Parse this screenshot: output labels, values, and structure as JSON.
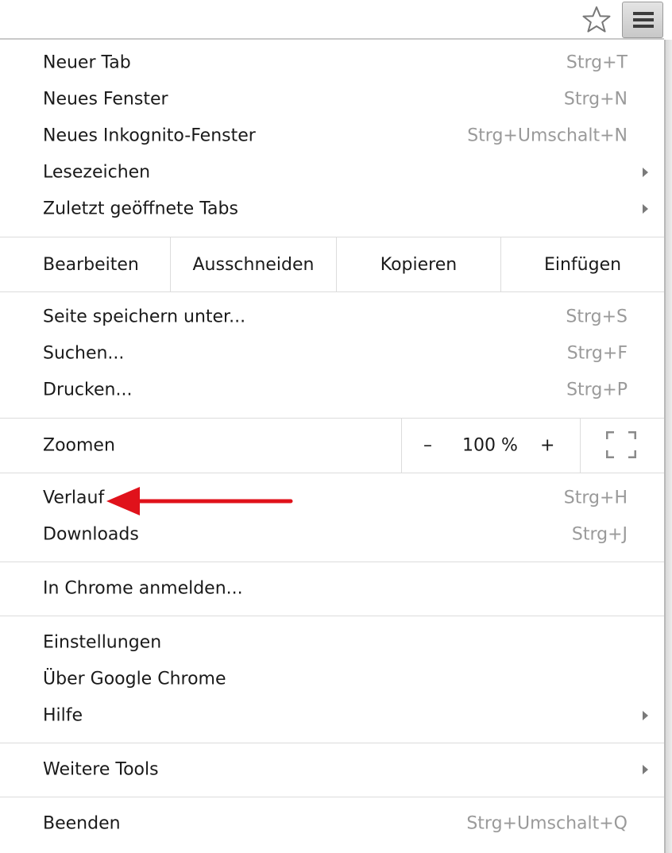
{
  "toolbar": {
    "bookmark_icon": "star-icon",
    "menu_icon": "hamburger-menu-icon"
  },
  "menu": {
    "group1": [
      {
        "label": "Neuer Tab",
        "shortcut": "Strg+T"
      },
      {
        "label": "Neues Fenster",
        "shortcut": "Strg+N"
      },
      {
        "label": "Neues Inkognito-Fenster",
        "shortcut": "Strg+Umschalt+N"
      },
      {
        "label": "Lesezeichen",
        "submenu": true
      },
      {
        "label": "Zuletzt geöffnete Tabs",
        "submenu": true
      }
    ],
    "edit": {
      "label": "Bearbeiten",
      "cut": "Ausschneiden",
      "copy": "Kopieren",
      "paste": "Einfügen"
    },
    "group2": [
      {
        "label": "Seite speichern unter...",
        "shortcut": "Strg+S"
      },
      {
        "label": "Suchen...",
        "shortcut": "Strg+F"
      },
      {
        "label": "Drucken...",
        "shortcut": "Strg+P"
      }
    ],
    "zoom": {
      "label": "Zoomen",
      "minus": "–",
      "value": "100 %",
      "plus": "+",
      "fullscreen_icon": "fullscreen-icon"
    },
    "group3": [
      {
        "label": "Verlauf",
        "shortcut": "Strg+H"
      },
      {
        "label": "Downloads",
        "shortcut": "Strg+J"
      }
    ],
    "signin": {
      "label": "In Chrome anmelden..."
    },
    "group4": [
      {
        "label": "Einstellungen"
      },
      {
        "label": "Über Google Chrome"
      },
      {
        "label": "Hilfe",
        "submenu": true
      }
    ],
    "tools": {
      "label": "Weitere Tools",
      "submenu": true
    },
    "quit": {
      "label": "Beenden",
      "shortcut": "Strg+Umschalt+Q"
    }
  },
  "colors": {
    "annotation_arrow": "#e0121b",
    "shortcut_text": "#9a9a9a",
    "separator": "#dcdcdc"
  }
}
